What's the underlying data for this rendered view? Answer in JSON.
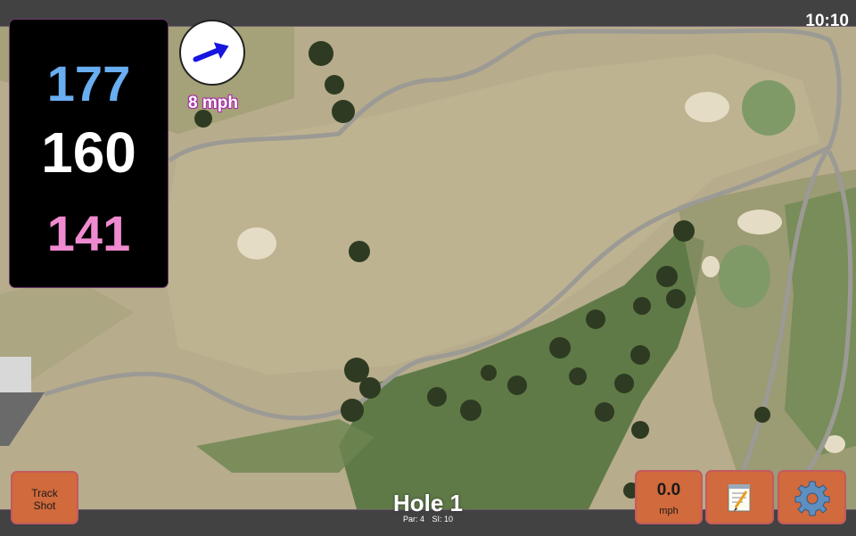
{
  "status_bar": {
    "time": "10:10"
  },
  "yardages": {
    "back": "177",
    "middle": "160",
    "front": "141"
  },
  "colors": {
    "back": "#6aaef2",
    "middle": "#ffffff",
    "front": "#f08ad0",
    "button": "#d16a3c",
    "wind_arrow": "#1616e0"
  },
  "wind": {
    "speed": "8 mph",
    "direction_icon": "wind-arrow-icon"
  },
  "buttons": {
    "track_shot_line1": "Track",
    "track_shot_line2": "Shot",
    "speed_value": "0.0",
    "speed_unit": "mph",
    "notes_icon": "notepad-icon",
    "settings_icon": "gear-icon"
  },
  "hole": {
    "title": "Hole 1",
    "par": "Par: 4",
    "si": "SI: 10"
  }
}
